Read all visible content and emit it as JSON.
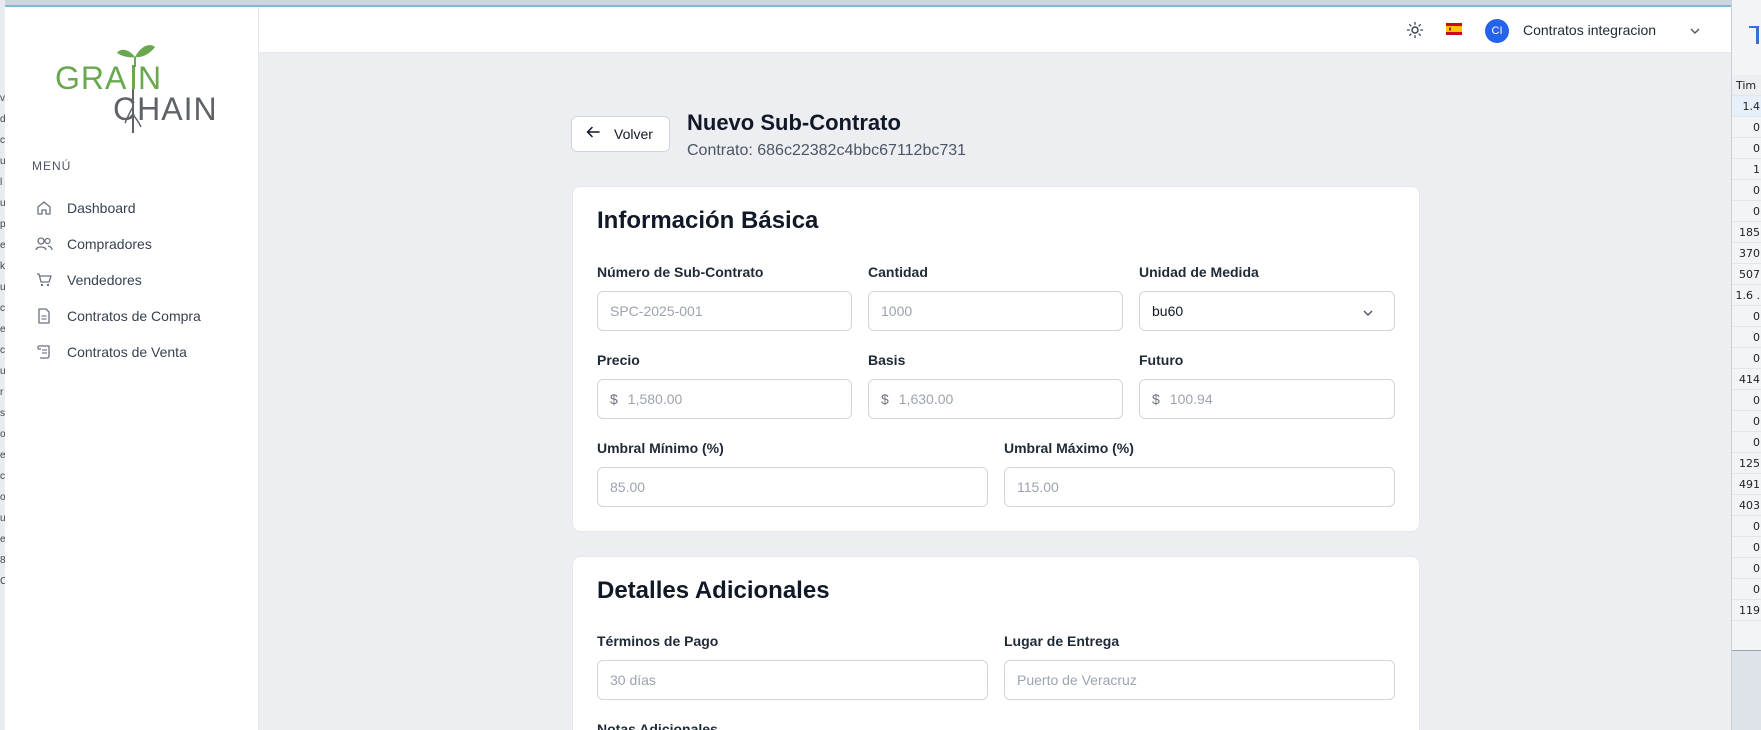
{
  "bg_left": {
    "chars": [
      "v",
      "d",
      "c",
      "u",
      "l",
      "u",
      "p",
      "e",
      "k",
      "u",
      "c",
      "e",
      "c",
      "u",
      "r",
      "s",
      "o",
      "e",
      "c",
      "o",
      "u",
      "e",
      "8",
      "C"
    ]
  },
  "bg_right": {
    "header": "Tim",
    "values": [
      "1.4",
      "0",
      "0",
      "1",
      "0",
      "0",
      "185",
      "370",
      "507",
      "1.6 .",
      "0",
      "0",
      "0",
      "414",
      "0",
      "0",
      "0",
      "125",
      "491",
      "403",
      "0",
      "0",
      "0",
      "0",
      "119"
    ]
  },
  "brand": {
    "word1": "GRAIN",
    "word2": "CHAIN",
    "green": "#6aa84f",
    "gray": "#5f6368"
  },
  "sidebar": {
    "menu_title": "MENÚ",
    "items": [
      {
        "label": "Dashboard",
        "icon": "home-icon"
      },
      {
        "label": "Compradores",
        "icon": "users-icon"
      },
      {
        "label": "Vendedores",
        "icon": "cart-icon"
      },
      {
        "label": "Contratos de Compra",
        "icon": "document-icon"
      },
      {
        "label": "Contratos de Venta",
        "icon": "scroll-icon"
      }
    ]
  },
  "topbar": {
    "avatar_initials": "CI",
    "user_name": "Contratos integracion",
    "language_flag": "es-flag-icon",
    "theme_icon": "sun-icon"
  },
  "header": {
    "back_label": "Volver",
    "title": "Nuevo Sub-Contrato",
    "subtitle": "Contrato: 686c22382c4bbc67112bc731"
  },
  "basic": {
    "title": "Información Básica",
    "numero": {
      "label": "Número de Sub-Contrato",
      "placeholder": "SPC-2025-001"
    },
    "cantidad": {
      "label": "Cantidad",
      "placeholder": "1000"
    },
    "unidad": {
      "label": "Unidad de Medida",
      "value": "bu60"
    },
    "precio": {
      "label": "Precio",
      "currency": "$",
      "placeholder": "1,580.00"
    },
    "basis": {
      "label": "Basis",
      "currency": "$",
      "placeholder": "1,630.00"
    },
    "futuro": {
      "label": "Futuro",
      "currency": "$",
      "placeholder": "100.94"
    },
    "umbral_min": {
      "label": "Umbral Mínimo (%)",
      "placeholder": "85.00"
    },
    "umbral_max": {
      "label": "Umbral Máximo (%)",
      "placeholder": "115.00"
    }
  },
  "extra": {
    "title": "Detalles Adicionales",
    "terminos": {
      "label": "Términos de Pago",
      "placeholder": "30 días"
    },
    "lugar": {
      "label": "Lugar de Entrega",
      "placeholder": "Puerto de Veracruz"
    },
    "notas": {
      "label": "Notas Adicionales"
    }
  },
  "colors": {
    "accent": "#2563eb",
    "page_bg": "#eceef2",
    "card_bg": "#ffffff",
    "border": "#d1d5db"
  }
}
